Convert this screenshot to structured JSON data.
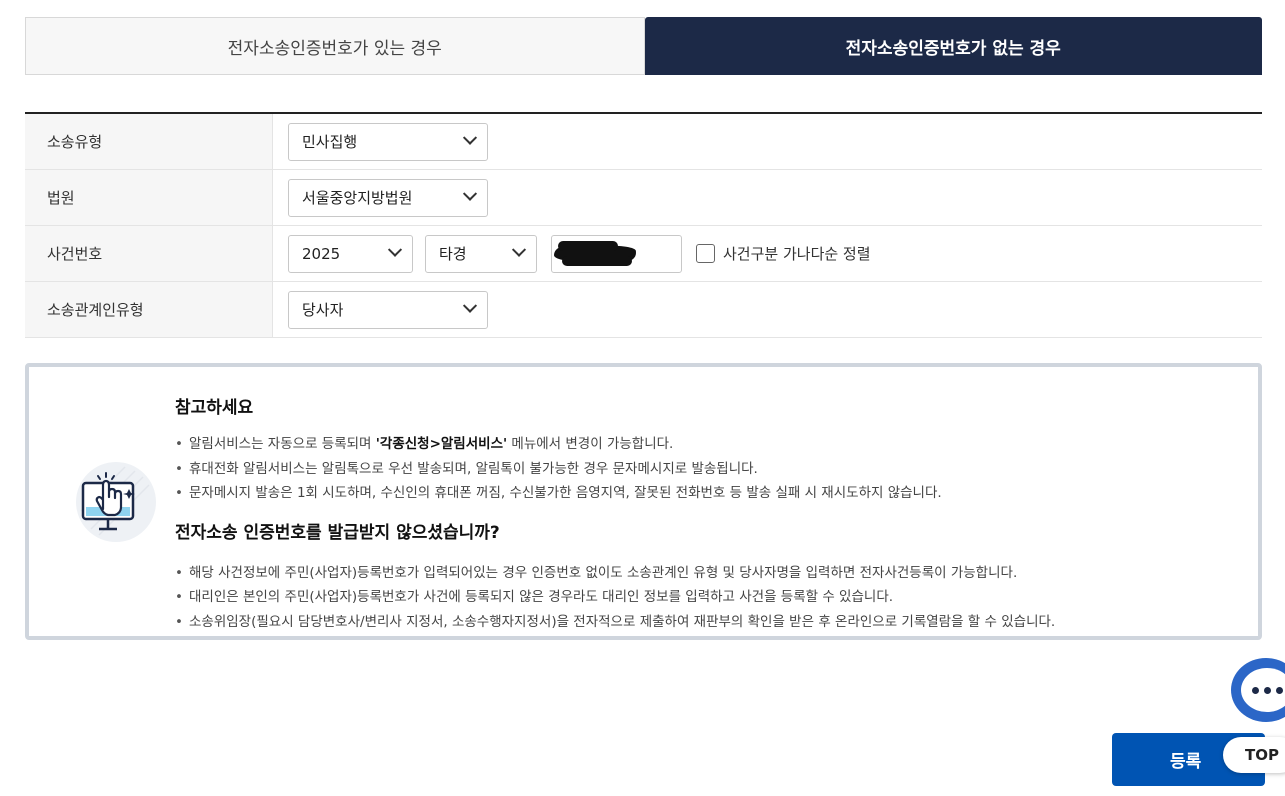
{
  "tabs": [
    {
      "label": "전자소송인증번호가 있는 경우",
      "active": false
    },
    {
      "label": "전자소송인증번호가 없는 경우",
      "active": true
    }
  ],
  "form": {
    "lawsuit_type": {
      "label": "소송유형",
      "value": "민사집행"
    },
    "court": {
      "label": "법원",
      "value": "서울중앙지방법원"
    },
    "case_number": {
      "label": "사건번호",
      "year": "2025",
      "category": "타경",
      "number": "",
      "sort_checkbox_label": "사건구분 가나다순 정렬"
    },
    "party_type": {
      "label": "소송관계인유형",
      "value": "당사자"
    }
  },
  "notice": {
    "title1": "참고하세요",
    "items1": [
      {
        "pre": "알림서비스는 자동으로 등록되며 ",
        "bold": "'각종신청>알림서비스'",
        "post": " 메뉴에서 변경이 가능합니다."
      },
      {
        "text": "휴대전화 알림서비스는 알림톡으로 우선 발송되며, 알림톡이 불가능한 경우 문자메시지로 발송됩니다."
      },
      {
        "text": "문자메시지 발송은 1회 시도하며, 수신인의 휴대폰 꺼짐, 수신불가한 음영지역, 잘못된 전화번호 등 발송 실패 시 재시도하지 않습니다."
      }
    ],
    "title2": "전자소송 인증번호를 발급받지 않으셨습니까?",
    "items2": [
      {
        "text": "해당 사건정보에 주민(사업자)등록번호가 입력되어있는 경우 인증번호 없이도 소송관계인 유형 및 당사자명을 입력하면 전자사건등록이 가능합니다."
      },
      {
        "text": "대리인은 본인의 주민(사업자)등록번호가 사건에 등록되지 않은 경우라도 대리인 정보를 입력하고 사건을 등록할 수 있습니다."
      },
      {
        "text": "소송위임장(필요시 담당변호사/변리사 지정서, 소송수행자지정서)을 전자적으로 제출하여 재판부의 확인을 받은 후 온라인으로 기록열람을 할 수 있습니다."
      }
    ]
  },
  "buttons": {
    "register": "등록",
    "top": "TOP"
  },
  "colors": {
    "active_tab": "#1c2947",
    "primary_button": "#0054b3",
    "chat_bubble": "#2b66c7"
  }
}
